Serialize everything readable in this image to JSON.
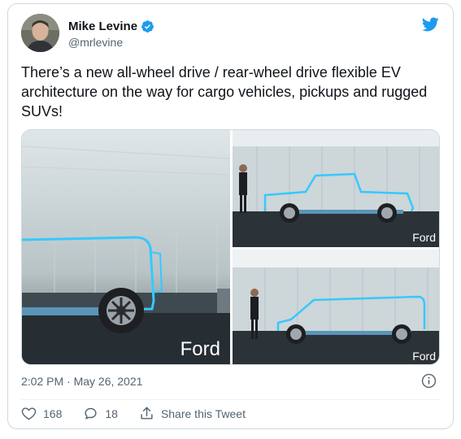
{
  "author": {
    "name": "Mike Levine",
    "handle": "@mrlevine"
  },
  "tweet": {
    "text": "There’s a new all-wheel drive / rear-wheel drive flexible EV architecture on the way for cargo vehicles, pickups and rugged SUVs!",
    "timestamp": "2:02 PM · May 26, 2021"
  },
  "media": {
    "brand_label_1": "Ford",
    "brand_label_2": "Ford",
    "brand_label_3": "Ford"
  },
  "actions": {
    "like_count": "168",
    "reply_count": "18",
    "share_label": "Share this Tweet"
  },
  "colors": {
    "twitter_blue": "#1d9bf0",
    "text_primary": "#0f1419",
    "text_secondary": "#536471",
    "outline_cyan": "#36c8ff"
  },
  "icons": [
    "verified-badge-icon",
    "twitter-bird-icon",
    "info-icon",
    "heart-icon",
    "reply-icon",
    "share-icon"
  ]
}
